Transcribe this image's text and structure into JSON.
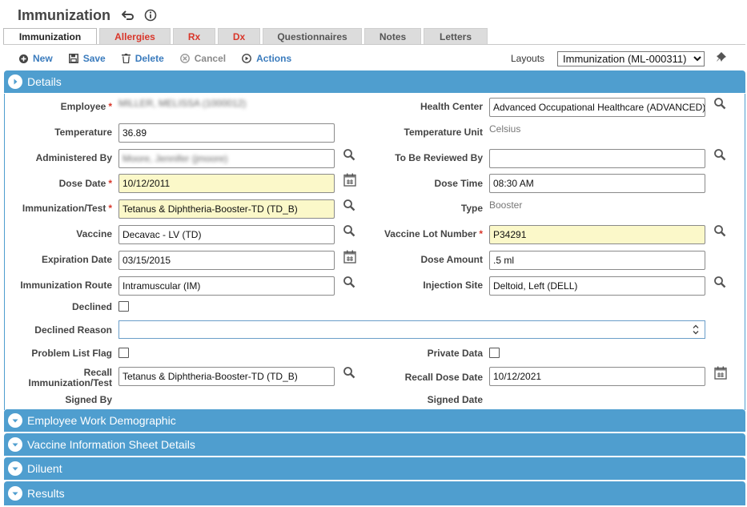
{
  "page": {
    "title": "Immunization"
  },
  "tabs": [
    {
      "label": "Immunization"
    },
    {
      "label": "Allergies"
    },
    {
      "label": "Rx"
    },
    {
      "label": "Dx"
    },
    {
      "label": "Questionnaires"
    },
    {
      "label": "Notes"
    },
    {
      "label": "Letters"
    }
  ],
  "toolbar": {
    "new_label": "New",
    "save_label": "Save",
    "delete_label": "Delete",
    "cancel_label": "Cancel",
    "actions_label": "Actions",
    "layouts_label": "Layouts",
    "layout_value": "Immunization (ML-000311)"
  },
  "sections": {
    "details": "Details",
    "work_demographic": "Employee Work Demographic",
    "vis_details": "Vaccine Information Sheet Details",
    "diluent": "Diluent",
    "results": "Results"
  },
  "form": {
    "employee": {
      "label": "Employee",
      "value": "MILLER, MELISSA (1000012)"
    },
    "health_center": {
      "label": "Health Center",
      "value": "Advanced Occupational Healthcare (ADVANCED)"
    },
    "temperature": {
      "label": "Temperature",
      "value": "36.89"
    },
    "temperature_unit": {
      "label": "Temperature Unit",
      "value": "Celsius"
    },
    "administered_by": {
      "label": "Administered By",
      "value": "Moore, Jennifer (jmoore)"
    },
    "to_be_reviewed_by": {
      "label": "To Be Reviewed By",
      "value": ""
    },
    "dose_date": {
      "label": "Dose Date",
      "value": "10/12/2011"
    },
    "dose_time": {
      "label": "Dose Time",
      "value": "08:30 AM"
    },
    "immunization_test": {
      "label": "Immunization/Test",
      "value": "Tetanus & Diphtheria-Booster-TD (TD_B)"
    },
    "type": {
      "label": "Type",
      "value": "Booster"
    },
    "vaccine": {
      "label": "Vaccine",
      "value": "Decavac - LV (TD)"
    },
    "vaccine_lot_number": {
      "label": "Vaccine Lot Number",
      "value": "P34291"
    },
    "expiration_date": {
      "label": "Expiration Date",
      "value": "03/15/2015"
    },
    "dose_amount": {
      "label": "Dose Amount",
      "value": ".5 ml"
    },
    "immunization_route": {
      "label": "Immunization Route",
      "value": "Intramuscular (IM)"
    },
    "injection_site": {
      "label": "Injection Site",
      "value": "Deltoid, Left (DELL)"
    },
    "declined": {
      "label": "Declined"
    },
    "declined_reason": {
      "label": "Declined Reason",
      "value": ""
    },
    "problem_list_flag": {
      "label": "Problem List Flag"
    },
    "private_data": {
      "label": "Private Data"
    },
    "recall_immunization": {
      "label_line1": "Recall",
      "label_line2": "Immunization/Test",
      "value": "Tetanus & Diphtheria-Booster-TD (TD_B)"
    },
    "recall_dose_date": {
      "label": "Recall Dose Date",
      "value": "10/12/2021"
    },
    "signed_by": {
      "label": "Signed By"
    },
    "signed_date": {
      "label": "Signed Date"
    }
  },
  "colors": {
    "accent": "#4f9ecf",
    "link": "#3a7bbd",
    "required": "#d9362a",
    "highlight_field": "#fbf8c9"
  },
  "icons": [
    "undo-icon",
    "info-icon",
    "plus-circle-icon",
    "save-icon",
    "trash-icon",
    "cancel-icon",
    "play-circle-icon",
    "pin-icon",
    "search-icon",
    "calendar-icon",
    "chevron-right-circle-icon",
    "chevron-down-circle-icon",
    "spinner-arrows-icon"
  ]
}
